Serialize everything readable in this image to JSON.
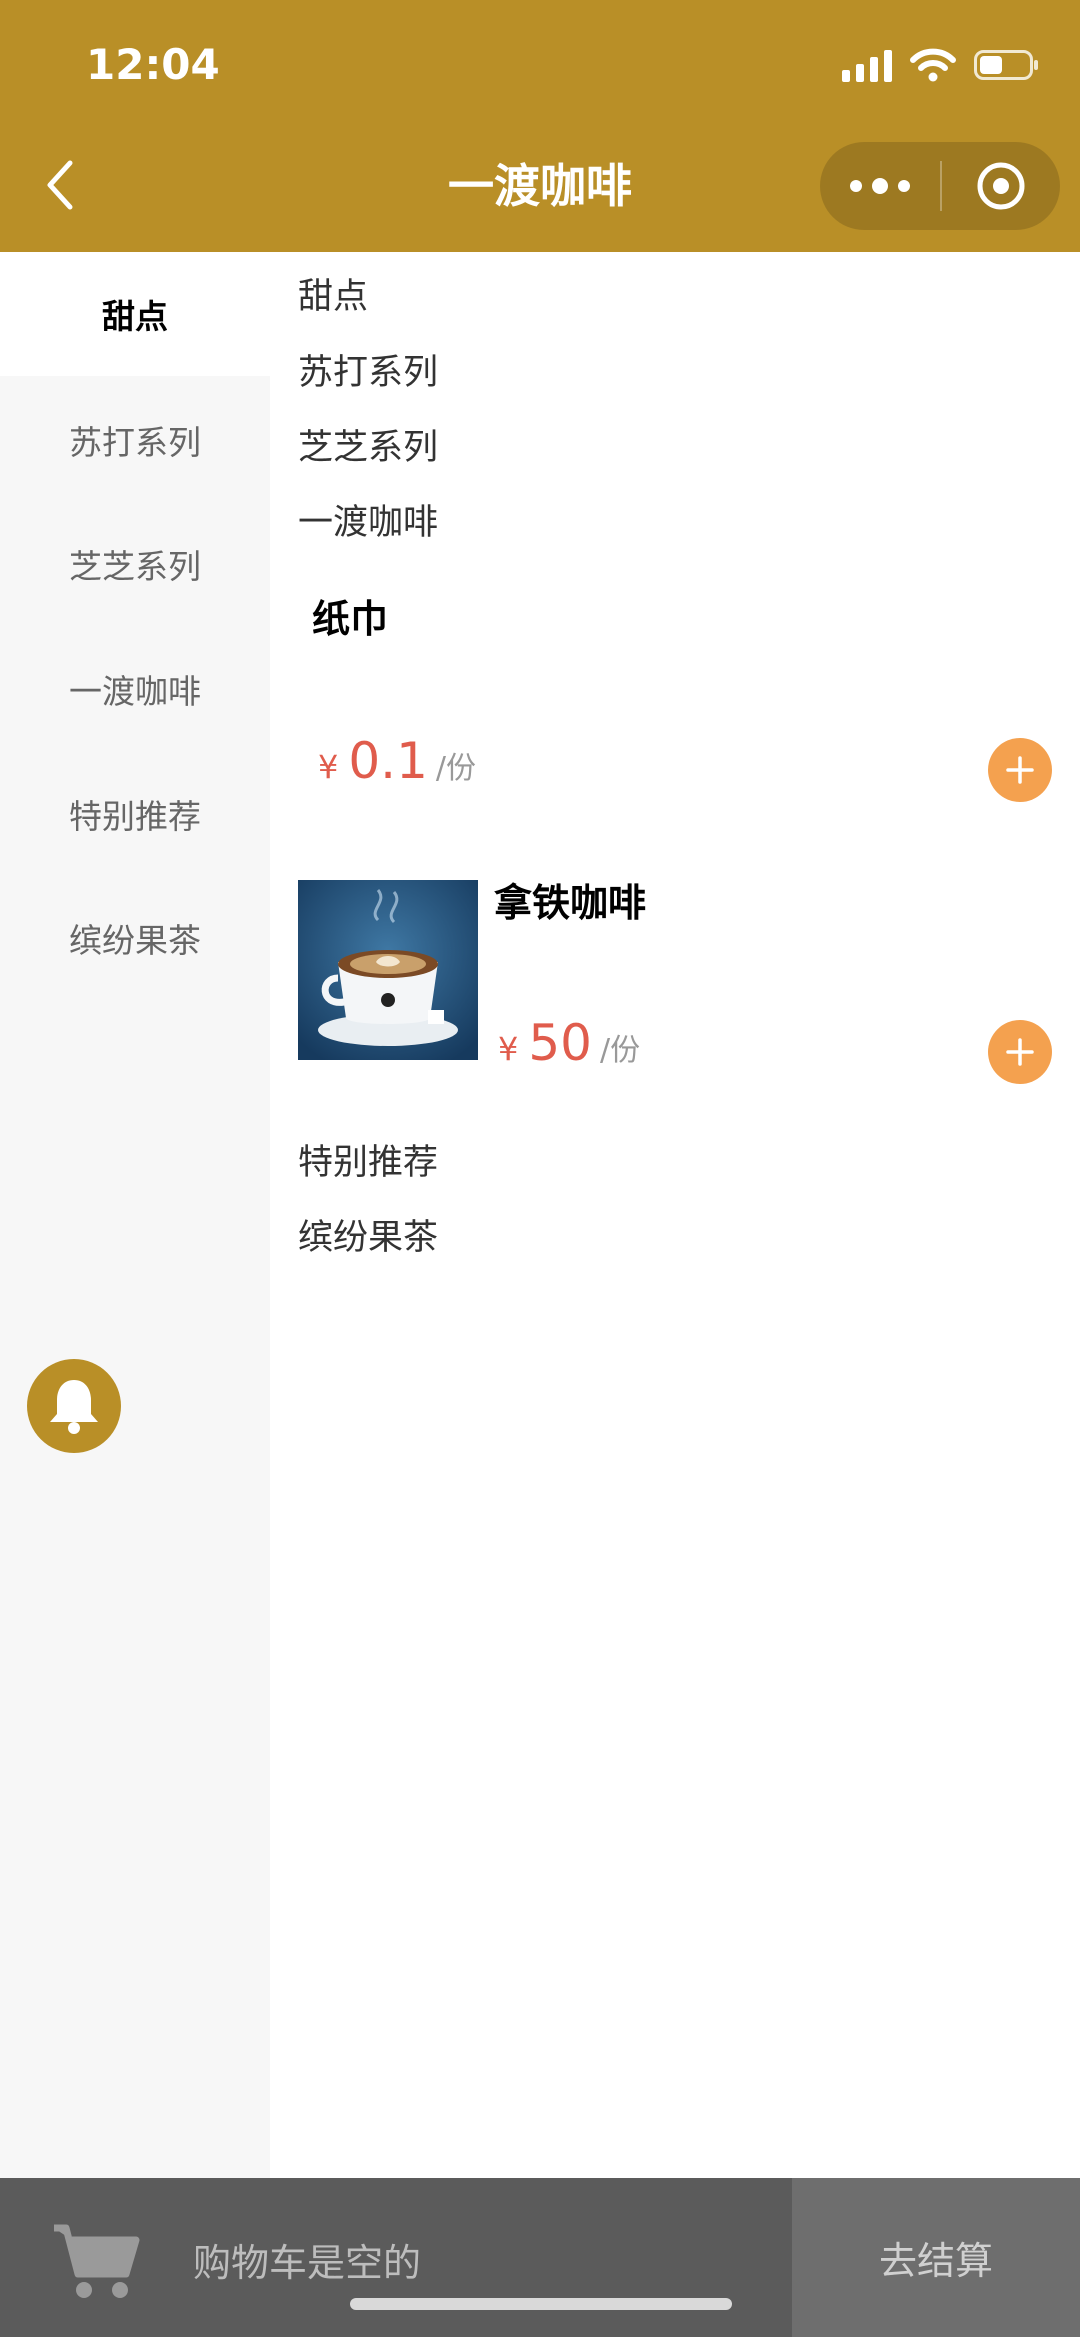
{
  "status_bar": {
    "time": "12:04"
  },
  "header": {
    "title": "一渡咖啡"
  },
  "sidebar": {
    "items": [
      {
        "label": "甜点",
        "active": true
      },
      {
        "label": "苏打系列"
      },
      {
        "label": "芝芝系列"
      },
      {
        "label": "一渡咖啡"
      },
      {
        "label": "特别推荐"
      },
      {
        "label": "缤纷果茶"
      }
    ]
  },
  "main": {
    "categories": [
      "甜点",
      "苏打系列",
      "芝芝系列",
      "一渡咖啡",
      "特别推荐",
      "缤纷果茶"
    ],
    "products": [
      {
        "name": "纸巾",
        "currency": "¥",
        "price": "0.1",
        "unit": "/份"
      },
      {
        "name": "拿铁咖啡",
        "currency": "¥",
        "price": "50",
        "unit": "/份"
      }
    ]
  },
  "bottom_bar": {
    "cart_text": "购物车是空的",
    "checkout_label": "去结算"
  },
  "colors": {
    "brand": "#B98F27",
    "price": "#E05C4C",
    "add_button": "#F4A14F"
  },
  "icons": [
    "back-arrow-icon",
    "more-dots-icon",
    "target-icon",
    "bell-icon",
    "add-icon",
    "cart-icon",
    "signal-icon",
    "wifi-icon",
    "battery-icon"
  ]
}
